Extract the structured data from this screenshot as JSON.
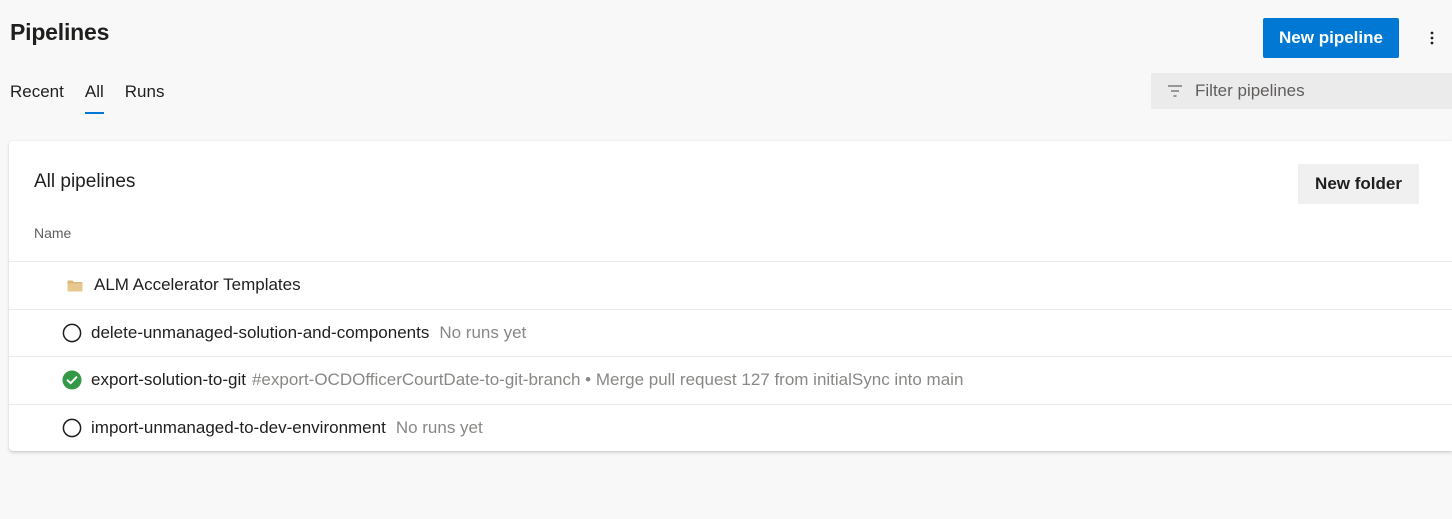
{
  "header": {
    "title": "Pipelines",
    "new_pipeline_label": "New pipeline",
    "more_icon": "more-vertical-icon"
  },
  "tabs": [
    {
      "label": "Recent",
      "active": false
    },
    {
      "label": "All",
      "active": true
    },
    {
      "label": "Runs",
      "active": false
    }
  ],
  "filter": {
    "placeholder": "Filter pipelines",
    "value": "",
    "icon": "filter-icon"
  },
  "card": {
    "title": "All pipelines",
    "new_folder_label": "New folder",
    "column_header": "Name"
  },
  "rows": [
    {
      "type": "folder",
      "icon": "folder-icon",
      "name": "ALM Accelerator Templates",
      "secondary": ""
    },
    {
      "type": "pipeline",
      "icon": "not-run-circle-icon",
      "status": "none",
      "name": "delete-unmanaged-solution-and-components",
      "secondary": "No runs yet"
    },
    {
      "type": "pipeline",
      "icon": "success-check-icon",
      "status": "succeeded",
      "name": "export-solution-to-git",
      "secondary": "#export-OCDOfficerCourtDate-to-git-branch • Merge pull request 127 from initialSync into main"
    },
    {
      "type": "pipeline",
      "icon": "not-run-circle-icon",
      "status": "none",
      "name": "import-unmanaged-to-dev-environment",
      "secondary": "No runs yet"
    }
  ],
  "colors": {
    "accent": "#0078d4",
    "success": "#339947",
    "folder": "#dcb67a"
  }
}
